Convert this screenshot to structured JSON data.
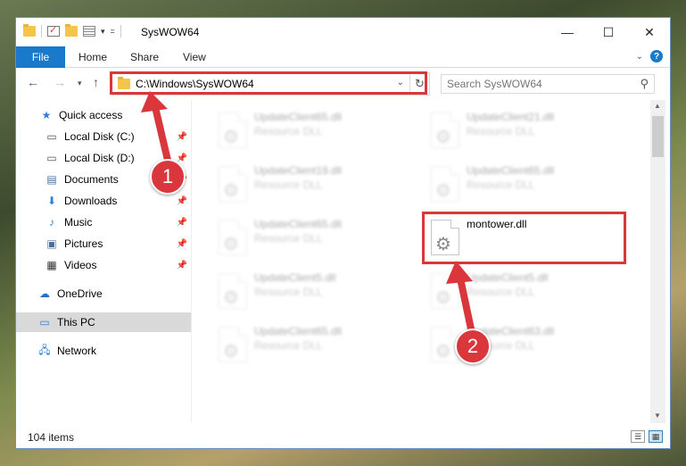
{
  "window": {
    "title": "SysWOW64",
    "controls": {
      "minimize": "—",
      "maximize": "☐",
      "close": "✕"
    }
  },
  "ribbon": {
    "tabs": [
      "File",
      "Home",
      "Share",
      "View"
    ],
    "help": "?"
  },
  "address_bar": {
    "path": "C:\\Windows\\SysWOW64"
  },
  "search": {
    "placeholder": "Search SysWOW64"
  },
  "sidebar": {
    "items": [
      {
        "label": "Quick access",
        "icon": "star-icon",
        "pinned": false
      },
      {
        "label": "Local Disk (C:)",
        "icon": "drive-icon",
        "pinned": true
      },
      {
        "label": "Local Disk (D:)",
        "icon": "drive-icon",
        "pinned": true
      },
      {
        "label": "Documents",
        "icon": "documents-icon",
        "pinned": true
      },
      {
        "label": "Downloads",
        "icon": "download-icon",
        "pinned": true
      },
      {
        "label": "Music",
        "icon": "music-icon",
        "pinned": true
      },
      {
        "label": "Pictures",
        "icon": "pictures-icon",
        "pinned": true
      },
      {
        "label": "Videos",
        "icon": "videos-icon",
        "pinned": true
      },
      {
        "label": "OneDrive",
        "icon": "cloud-icon",
        "pinned": false
      },
      {
        "label": "This PC",
        "icon": "computer-icon",
        "pinned": false,
        "selected": true
      },
      {
        "label": "Network",
        "icon": "network-icon",
        "pinned": false
      }
    ]
  },
  "files": [
    {
      "name": "UpdateClient65.dll",
      "type": "Resource DLL",
      "blurred": true
    },
    {
      "name": "UpdateClient21.dll",
      "type": "Resource DLL",
      "blurred": true
    },
    {
      "name": "UpdateClient19.dll",
      "type": "Resource DLL",
      "blurred": true
    },
    {
      "name": "UpdateClient65.dll",
      "type": "Resource DLL",
      "blurred": true
    },
    {
      "name": "UpdateClient65.dll",
      "type": "Resource DLL",
      "blurred": true
    },
    {
      "name": "montower.dll",
      "type": "",
      "blurred": false,
      "highlighted": true
    },
    {
      "name": "UpdateClient5.dll",
      "type": "Resource DLL",
      "blurred": true
    },
    {
      "name": "UpdateClient5.dll",
      "type": "Resource DLL",
      "blurred": true
    },
    {
      "name": "UpdateClient65.dll",
      "type": "Resource DLL",
      "blurred": true
    },
    {
      "name": "UpdateClient63.dll",
      "type": "Resource DLL",
      "blurred": true
    }
  ],
  "status": {
    "item_count": "104 items"
  },
  "callouts": [
    {
      "number": "1"
    },
    {
      "number": "2"
    }
  ],
  "colors": {
    "accent": "#1979ca",
    "highlight": "#d9373b",
    "selected": "#d9d9d9"
  }
}
